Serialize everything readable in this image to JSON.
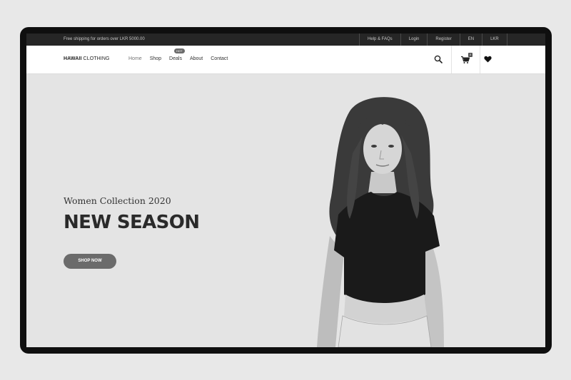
{
  "topbar": {
    "promo": "Free shipping for orders over LKR 5000.00",
    "links": [
      "Help & FAQs",
      "Login",
      "Register",
      "EN",
      "LKR"
    ]
  },
  "header": {
    "logo_bold": "HAWAII",
    "logo_light": " CLOTHING",
    "menu": [
      "Home",
      "Shop",
      "Deals",
      "About",
      "Contact"
    ],
    "active": "Home",
    "deals_badge": "HOT",
    "cart_count": "0",
    "icons": [
      "search-icon",
      "cart-icon",
      "heart-icon"
    ]
  },
  "hero": {
    "subtitle": "Women Collection 2020",
    "title": "NEW SEASON",
    "button": "SHOP NOW"
  },
  "colors": {
    "topbar_bg": "#262626",
    "hero_bg": "#e4e4e4",
    "button_bg": "#6b6b6b",
    "device_frame": "#0f0f0f"
  }
}
